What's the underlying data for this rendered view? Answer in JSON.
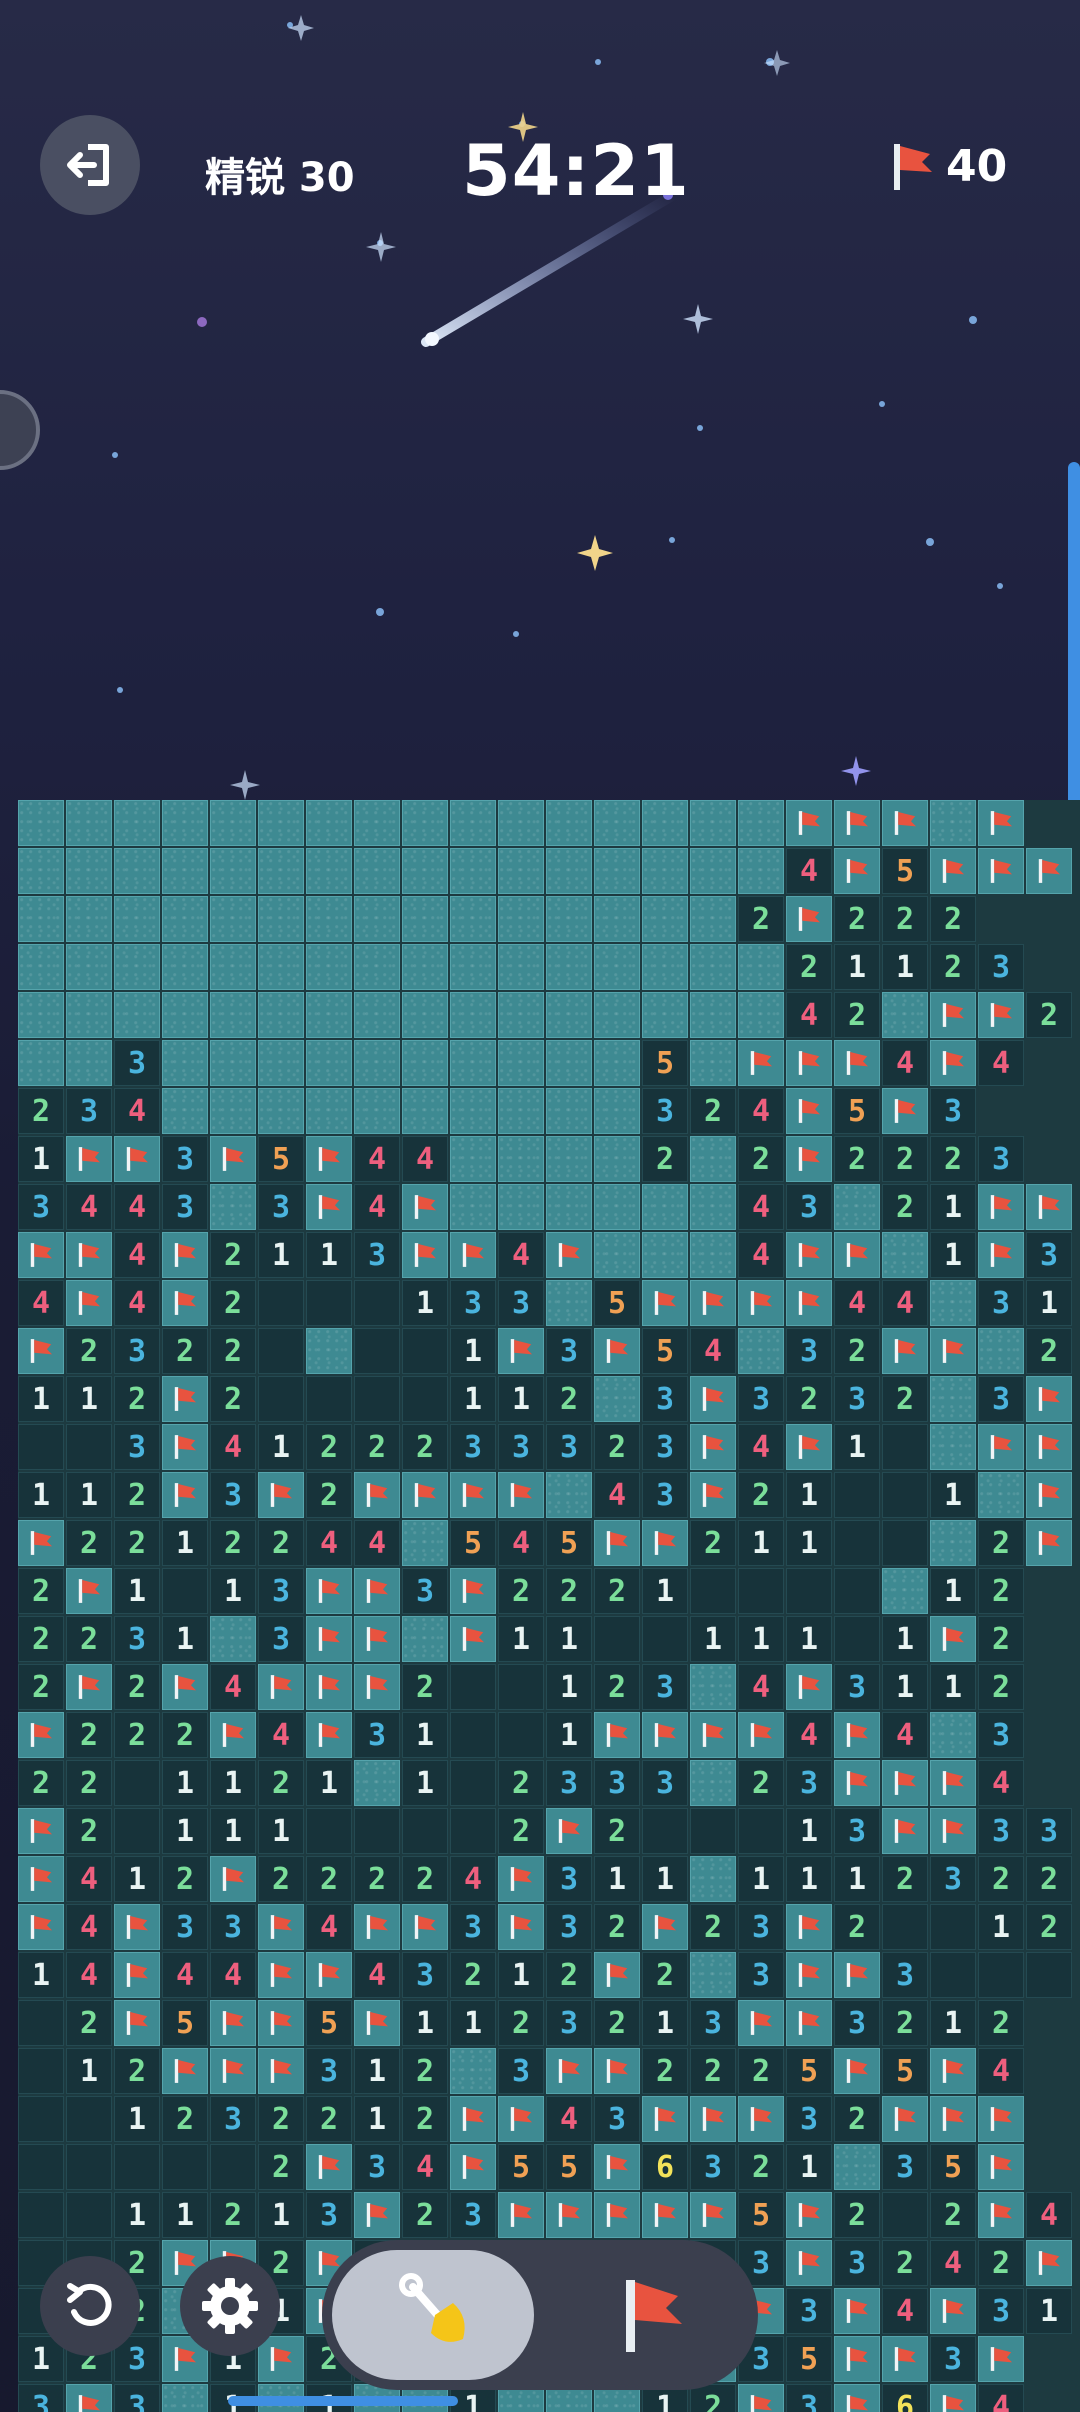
{
  "header": {
    "mode_label": "精锐 30",
    "timer": "54:21",
    "flags_remaining": "40"
  },
  "icons": {
    "exit": "exit-icon",
    "flag": "flag-icon",
    "restart": "restart-icon",
    "settings": "gear-icon",
    "dig": "shovel-icon"
  },
  "colors": {
    "covered_tile": "#3e8a92",
    "open_tile": "#17333a",
    "flag": "#e8533f",
    "num1": "#e9f4f3",
    "num2": "#7bde9a",
    "num3": "#4ab4de",
    "num4": "#ee5f7e",
    "num5": "#f0a154",
    "num6": "#f3e35a"
  },
  "board": {
    "legend": "#=covered, F=flag, .=revealed empty, digits=revealed count",
    "rows": [
      "################FFF#F",
      "################4F5FFF",
      "###############2F222",
      "################21123",
      "################42#FF2",
      "##3##########5#FFF4F4",
      "234##########324F5F3",
      "1FF3F5F44####2#2F2223",
      "3443#3F4F######43#21FF",
      "FF4F2113FF4F###4FF#1F3",
      "4F4F2...133#5FFFF44#31",
      "F2322.#..1F3F54#32FF#2",
      "112F2....112#3F3232#3F",
      "..3F4122233323F4F1.#FF",
      "112F3F2FFFF#43F21..1#F",
      "F2212244#545FF211..#2F",
      "2F1.13FF3F2221....#12",
      "2231#3FF#F11..111.1F2",
      "2F2F4FFF2..123#4F3112",
      "F222F4F31..1FFFF4F4#3",
      "22.1121#1.2333#23FFF4",
      "F2.111....2F2...13FF33",
      "F412F22224F311#1112322",
      "F4F33F4FF3F32F23F2..12",
      "14F44FF43212F2#3FF3...",
      ".2F5FF5F1123213FF3212",
      ".12FFF312#3FF2225F5F4",
      "..1232212FF43FFF32FFF",
      ".....2F34F55F6321#35F",
      "..11213F23FFFFF5F2.2F4",
      "..2FF2F2#2FF2233F3242F",
      "..2#F1F#F#2#5F3F3F4F31",
      "123F1F23#3F2F3F35FF3F",
      "3F3#1#1##1###12F3F6F4"
    ]
  }
}
